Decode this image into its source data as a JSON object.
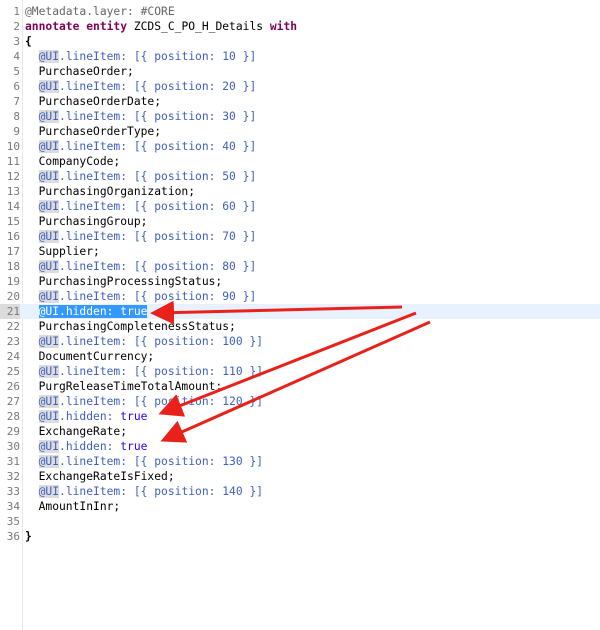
{
  "lines": [
    {
      "n": "1",
      "text": "@Metadata.layer: #CORE"
    },
    {
      "n": "2",
      "text": "annotate entity ZCDS_C_PO_H_Details with"
    },
    {
      "n": "3",
      "text": "{"
    },
    {
      "n": "4",
      "text": "  @UI.lineItem: [{ position: 10 }]"
    },
    {
      "n": "5",
      "text": "  PurchaseOrder;"
    },
    {
      "n": "6",
      "text": "  @UI.lineItem: [{ position: 20 }]"
    },
    {
      "n": "7",
      "text": "  PurchaseOrderDate;"
    },
    {
      "n": "8",
      "text": "  @UI.lineItem: [{ position: 30 }]"
    },
    {
      "n": "9",
      "text": "  PurchaseOrderType;"
    },
    {
      "n": "10",
      "text": "  @UI.lineItem: [{ position: 40 }]"
    },
    {
      "n": "11",
      "text": "  CompanyCode;"
    },
    {
      "n": "12",
      "text": "  @UI.lineItem: [{ position: 50 }]"
    },
    {
      "n": "13",
      "text": "  PurchasingOrganization;"
    },
    {
      "n": "14",
      "text": "  @UI.lineItem: [{ position: 60 }]"
    },
    {
      "n": "15",
      "text": "  PurchasingGroup;"
    },
    {
      "n": "16",
      "text": "  @UI.lineItem: [{ position: 70 }]"
    },
    {
      "n": "17",
      "text": "  Supplier;"
    },
    {
      "n": "18",
      "text": "  @UI.lineItem: [{ position: 80 }]"
    },
    {
      "n": "19",
      "text": "  PurchasingProcessingStatus;"
    },
    {
      "n": "20",
      "text": "  @UI.lineItem: [{ position: 90 }]"
    },
    {
      "n": "21",
      "text": "  @UI.hidden: true"
    },
    {
      "n": "22",
      "text": "  PurchasingCompletenessStatus;"
    },
    {
      "n": "23",
      "text": "  @UI.lineItem: [{ position: 100 }]"
    },
    {
      "n": "24",
      "text": "  DocumentCurrency;"
    },
    {
      "n": "25",
      "text": "  @UI.lineItem: [{ position: 110 }]"
    },
    {
      "n": "26",
      "text": "  PurgReleaseTimeTotalAmount;"
    },
    {
      "n": "27",
      "text": "  @UI.lineItem: [{ position: 120 }]"
    },
    {
      "n": "28",
      "text": "  @UI.hidden: true"
    },
    {
      "n": "29",
      "text": "  ExchangeRate;"
    },
    {
      "n": "30",
      "text": "  @UI.hidden: true"
    },
    {
      "n": "31",
      "text": "  @UI.lineItem: [{ position: 130 }]"
    },
    {
      "n": "32",
      "text": "  ExchangeRateIsFixed;"
    },
    {
      "n": "33",
      "text": "  @UI.lineItem: [{ position: 140 }]"
    },
    {
      "n": "34",
      "text": "  AmountInInr;"
    },
    {
      "n": "35",
      "text": ""
    },
    {
      "n": "36",
      "text": "}"
    }
  ],
  "current_line": "21",
  "selection_text": "@UI.hidden: true",
  "arrow_color": "#e8221b",
  "annotation_arrows_target_lines": [
    "21",
    "28",
    "30"
  ]
}
